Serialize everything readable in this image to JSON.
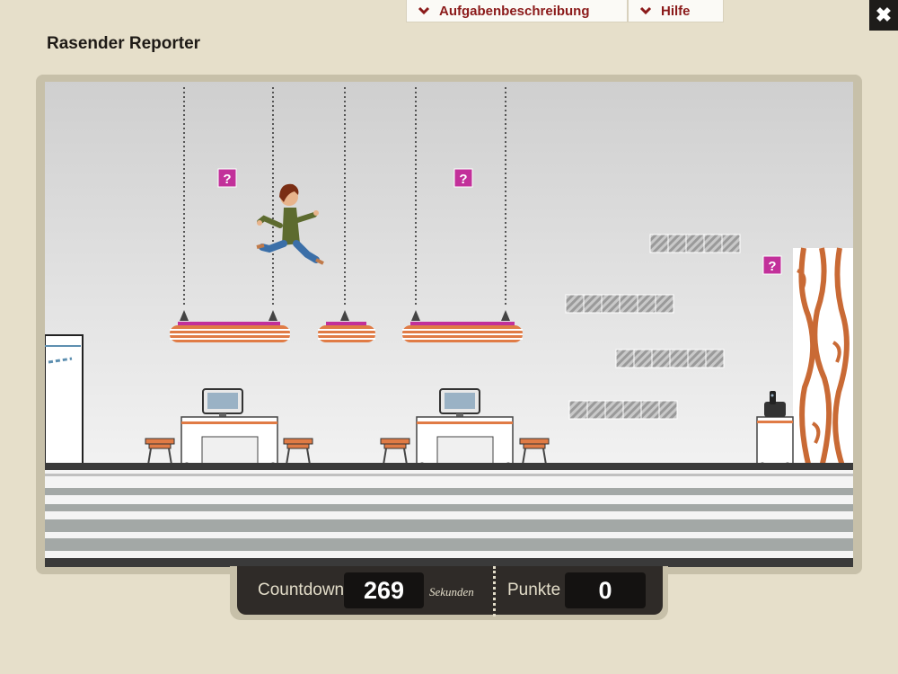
{
  "header": {
    "tabs": [
      {
        "label": "Aufgabenbeschreibung"
      },
      {
        "label": "Hilfe"
      }
    ],
    "close_icon": "close-icon"
  },
  "game": {
    "title": "Rasender Reporter",
    "hud": {
      "countdown_label": "Countdown",
      "countdown_value": "269",
      "countdown_unit": "Sekunden",
      "points_label": "Punkte",
      "points_value": "0"
    },
    "question_block_text": "?",
    "colors": {
      "accent_magenta": "#c2309a",
      "accent_orange": "#e07b45",
      "tab_text": "#8b1a1a",
      "hud_bg": "#2f2b28"
    }
  }
}
